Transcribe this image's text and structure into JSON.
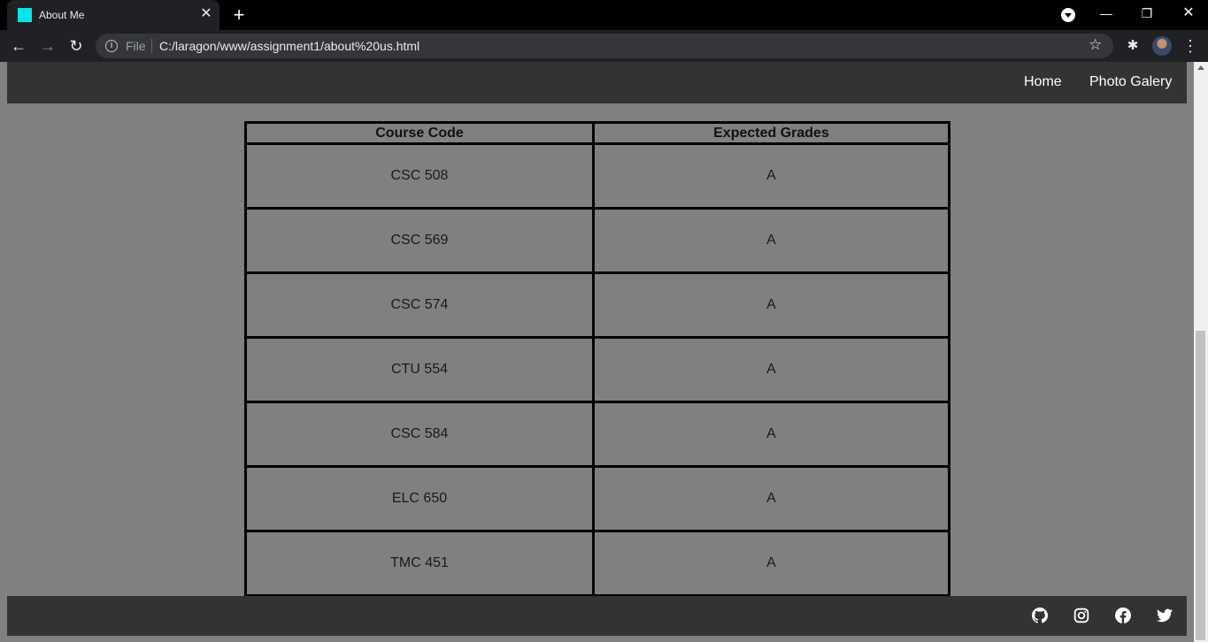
{
  "browser": {
    "tab_title": "About Me",
    "tab_close": "✕",
    "new_tab": "+",
    "scheme": "File",
    "url": "C:/laragon/www/assignment1/about%20us.html",
    "menu": "⋮"
  },
  "nav": {
    "home": "Home",
    "gallery": "Photo Galery"
  },
  "table": {
    "headers": [
      "Course Code",
      "Expected Grades"
    ],
    "rows": [
      [
        "CSC 508",
        "A"
      ],
      [
        "CSC 569",
        "A"
      ],
      [
        "CSC 574",
        "A"
      ],
      [
        "CTU 554",
        "A"
      ],
      [
        "CSC 584",
        "A"
      ],
      [
        "ELC 650",
        "A"
      ],
      [
        "TMC 451",
        "A"
      ]
    ]
  },
  "footer": {
    "icons": [
      "github-icon",
      "instagram-icon",
      "facebook-icon",
      "twitter-icon"
    ]
  },
  "colors": {
    "page_background": "#808080",
    "nav_background": "#333333",
    "favicon": "#00e5e5"
  }
}
